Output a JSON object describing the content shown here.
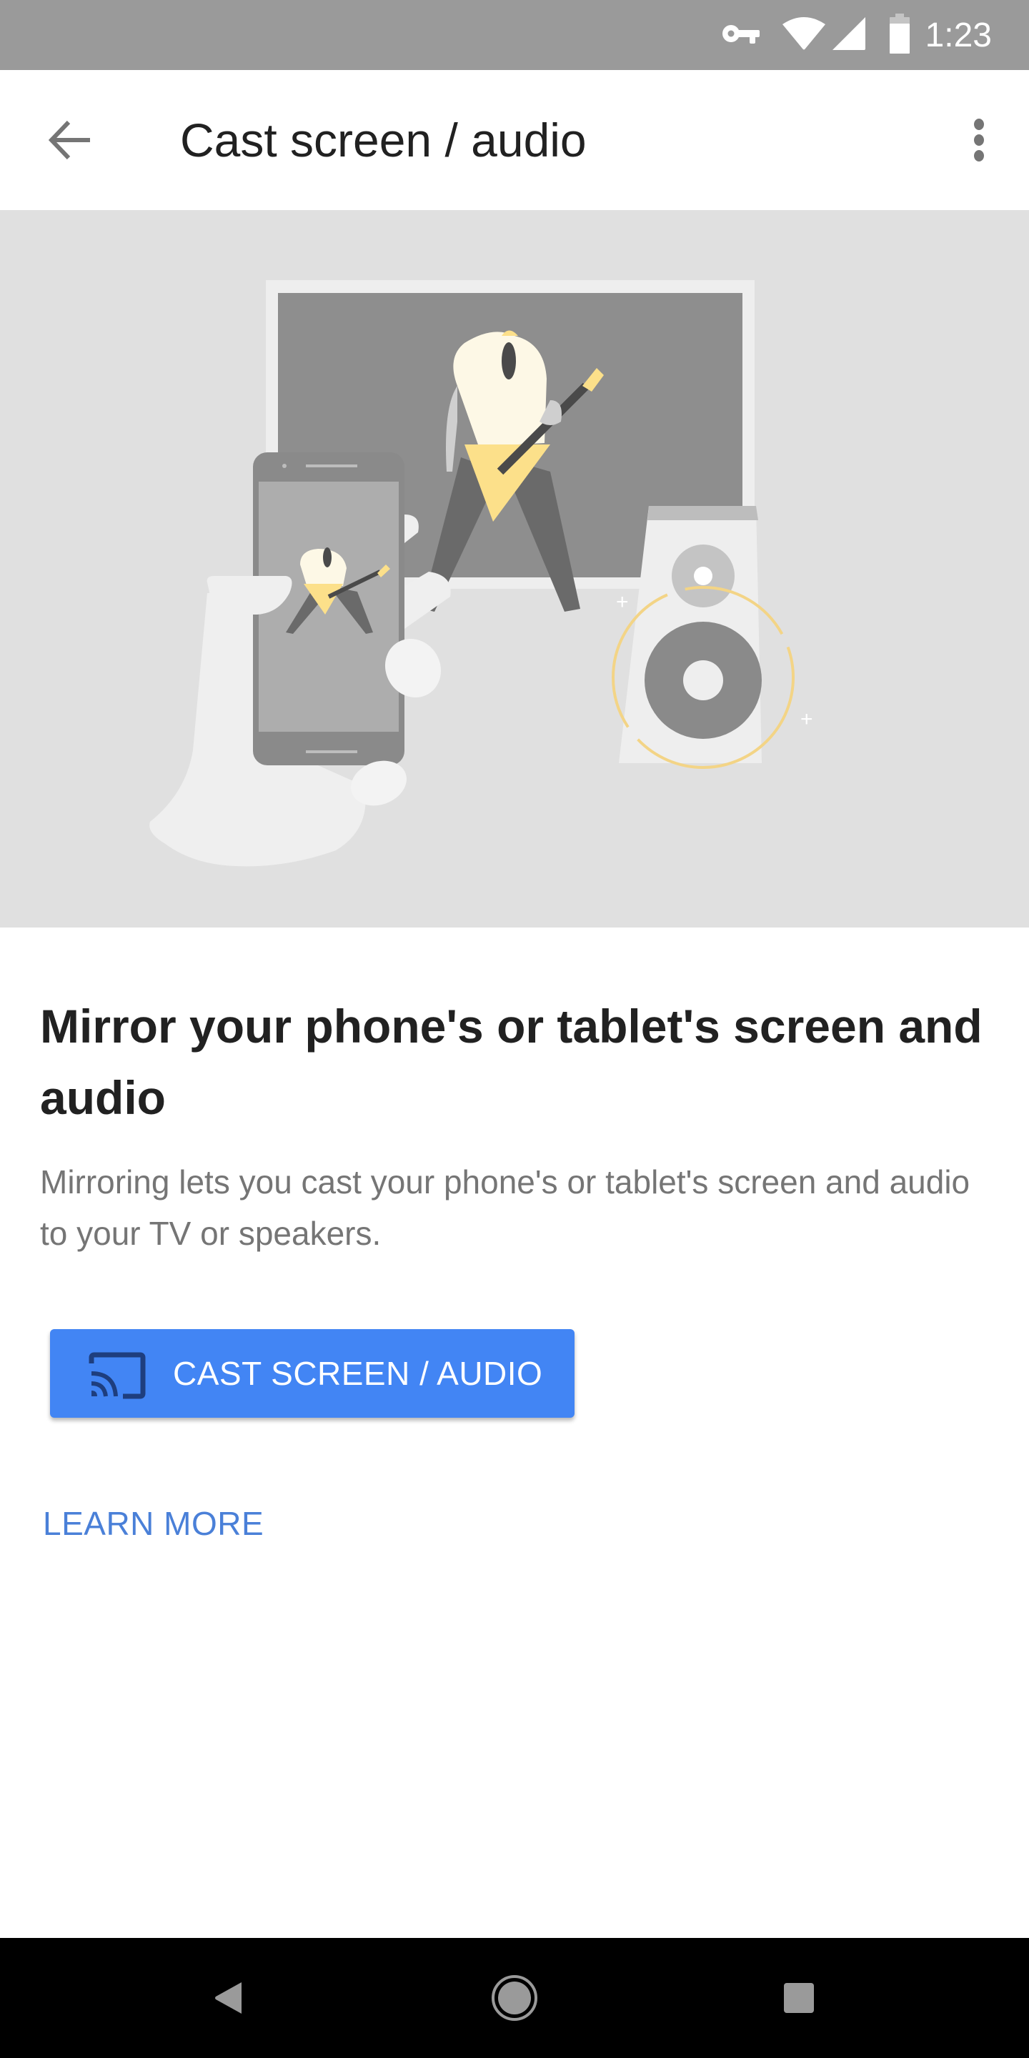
{
  "status_bar": {
    "time": "1:23",
    "icons": [
      "vpn-key-icon",
      "wifi-icon",
      "cellular-signal-icon",
      "battery-icon"
    ]
  },
  "toolbar": {
    "back_icon": "arrow-back-icon",
    "title": "Cast screen / audio",
    "overflow_icon": "more-vert-icon"
  },
  "hero": {
    "description": "Illustration of a hand holding a phone mirroring a guitarist onto a TV and a speaker",
    "colors": {
      "background": "#e0e0e0",
      "accent_yellow": "#fce08a",
      "figure_shirt": "#fdf8e6"
    }
  },
  "content": {
    "heading": "Mirror your phone's or tablet's screen and audio",
    "body": "Mirroring lets you cast your phone's or tablet's screen and audio to your TV or speakers."
  },
  "actions": {
    "cast_button_label": "CAST SCREEN / AUDIO",
    "cast_button_icon": "cast-icon",
    "learn_more_label": "LEARN MORE"
  },
  "colors": {
    "primary": "#4285f4",
    "link": "#4a80d8",
    "status_bar": "#9a9a9a",
    "nav_bar": "#000000"
  },
  "nav_bar": {
    "buttons": [
      "back-nav-icon",
      "home-nav-icon",
      "recents-nav-icon"
    ]
  }
}
